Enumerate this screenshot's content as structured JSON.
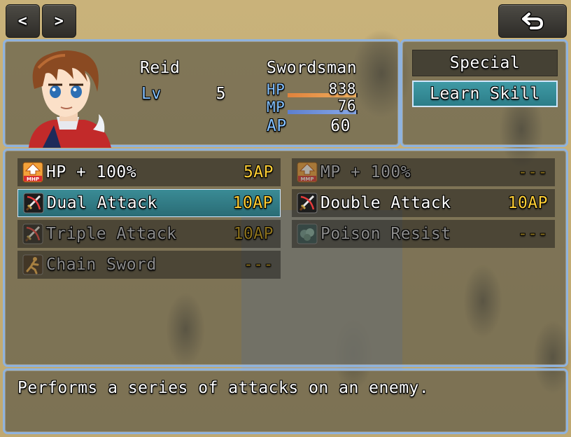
{
  "nav": {
    "prev_label": "<",
    "next_label": ">",
    "back_icon": "return-arrow-icon"
  },
  "actor": {
    "name": "Reid",
    "class": "Swordsman",
    "level_label": "Lv",
    "level": "5",
    "hp_label": "HP",
    "hp": "838",
    "hp_fraction": 0.98,
    "mp_label": "MP",
    "mp": "76",
    "mp_fraction": 0.98,
    "ap_label": "AP",
    "ap": "60"
  },
  "commands": [
    {
      "label": "Special",
      "selected": false
    },
    {
      "label": "Learn Skill",
      "selected": true
    }
  ],
  "skills": [
    {
      "name": "HP + 100%",
      "cost": "5AP",
      "icon": "mhp-up-icon",
      "enabled": true,
      "selected": false
    },
    {
      "name": "MP + 100%",
      "cost": "---",
      "icon": "mmp-up-icon",
      "enabled": false,
      "selected": false
    },
    {
      "name": "Dual Attack",
      "cost": "10AP",
      "icon": "sword-slash-icon",
      "enabled": true,
      "selected": true
    },
    {
      "name": "Double Attack",
      "cost": "10AP",
      "icon": "sword-slash-icon",
      "enabled": true,
      "selected": false
    },
    {
      "name": "Triple Attack",
      "cost": "10AP",
      "icon": "sword-slash-icon",
      "enabled": false,
      "selected": false
    },
    {
      "name": "Poison Resist",
      "cost": "---",
      "icon": "poison-cloud-icon",
      "enabled": false,
      "selected": false
    },
    {
      "name": "Chain Sword",
      "cost": "---",
      "icon": "running-figure-icon",
      "enabled": false,
      "selected": false
    }
  ],
  "help_text": "Performs a series of attacks on an enemy.",
  "colors": {
    "window_border": "#8fb3de",
    "system_text": "#84c1ff",
    "ap_cost": "#ffcf35",
    "hp_gauge": "#e8944a",
    "mp_gauge": "#6d8fd6",
    "selection": "#3a8b95"
  }
}
